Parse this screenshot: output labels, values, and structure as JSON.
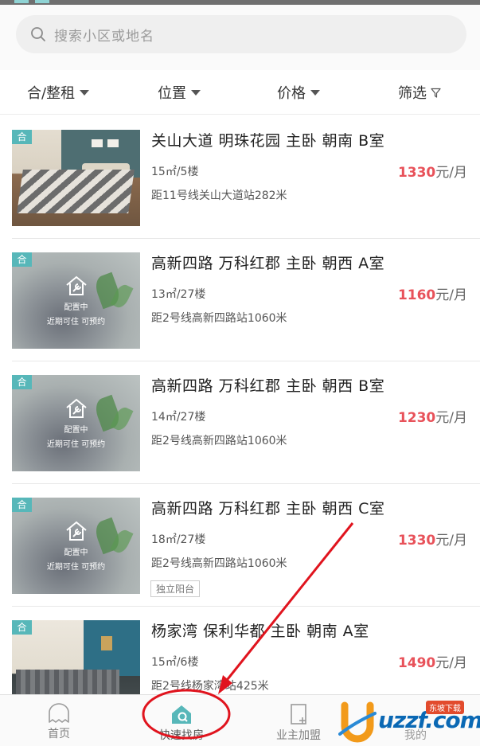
{
  "search": {
    "placeholder": "搜索小区或地名"
  },
  "filters": [
    {
      "label": "合/整租"
    },
    {
      "label": "位置"
    },
    {
      "label": "价格"
    },
    {
      "label": "筛选"
    }
  ],
  "listings": [
    {
      "badge": "合",
      "title": "关山大道 明珠花园 主卧 朝南 B室",
      "size_floor": "15㎡/5楼",
      "distance": "距11号线关山大道站282米",
      "price_num": "1330",
      "price_unit": "元/月",
      "image": "bedroom-photo"
    },
    {
      "badge": "合",
      "title": "高新四路 万科红郡 主卧 朝西 A室",
      "size_floor": "13㎡/27楼",
      "distance": "距2号线高新四路站1060米",
      "price_num": "1160",
      "price_unit": "元/月",
      "image": "placeholder",
      "ph_line1": "配置中",
      "ph_line2": "近期可住 可预约"
    },
    {
      "badge": "合",
      "title": "高新四路 万科红郡 主卧 朝西 B室",
      "size_floor": "14㎡/27楼",
      "distance": "距2号线高新四路站1060米",
      "price_num": "1230",
      "price_unit": "元/月",
      "image": "placeholder",
      "ph_line1": "配置中",
      "ph_line2": "近期可住 可预约"
    },
    {
      "badge": "合",
      "title": "高新四路 万科红郡 主卧 朝西 C室",
      "size_floor": "18㎡/27楼",
      "distance": "距2号线高新四路站1060米",
      "price_num": "1330",
      "price_unit": "元/月",
      "image": "placeholder",
      "ph_line1": "配置中",
      "ph_line2": "近期可住 可预约",
      "tag": "独立阳台"
    },
    {
      "badge": "合",
      "title": "杨家湾 保利华都 主卧 朝南 A室",
      "size_floor": "15㎡/6楼",
      "distance": "距2号线杨家湾站425米",
      "price_num": "1490",
      "price_unit": "元/月",
      "image": "bedroom-photo-2"
    }
  ],
  "tabbar": [
    {
      "label": "首页",
      "icon": "home-ghost-icon"
    },
    {
      "label": "快速找房",
      "icon": "house-search-icon",
      "active": true
    },
    {
      "label": "业主加盟",
      "icon": "owner-join-icon"
    },
    {
      "label": "我的",
      "icon": "profile-icon"
    }
  ],
  "watermark": {
    "text": "uzzf.com",
    "sub": "东坡下载"
  },
  "colors": {
    "accent": "#57b7b9",
    "price": "#e8525a",
    "annotation": "#e0141e"
  }
}
